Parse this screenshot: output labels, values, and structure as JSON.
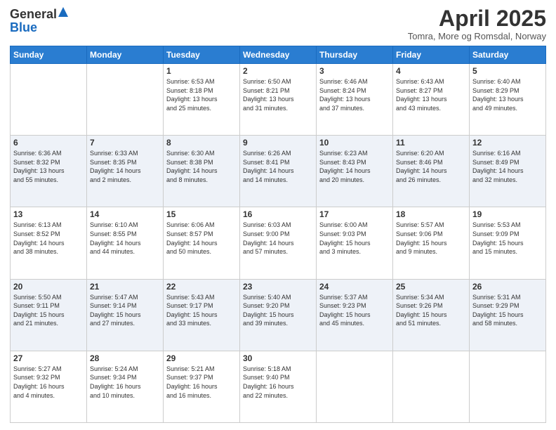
{
  "header": {
    "logo_line1": "General",
    "logo_line2": "Blue",
    "month_title": "April 2025",
    "location": "Tomra, More og Romsdal, Norway"
  },
  "days_of_week": [
    "Sunday",
    "Monday",
    "Tuesday",
    "Wednesday",
    "Thursday",
    "Friday",
    "Saturday"
  ],
  "weeks": [
    [
      {
        "day": "",
        "content": ""
      },
      {
        "day": "",
        "content": ""
      },
      {
        "day": "1",
        "content": "Sunrise: 6:53 AM\nSunset: 8:18 PM\nDaylight: 13 hours\nand 25 minutes."
      },
      {
        "day": "2",
        "content": "Sunrise: 6:50 AM\nSunset: 8:21 PM\nDaylight: 13 hours\nand 31 minutes."
      },
      {
        "day": "3",
        "content": "Sunrise: 6:46 AM\nSunset: 8:24 PM\nDaylight: 13 hours\nand 37 minutes."
      },
      {
        "day": "4",
        "content": "Sunrise: 6:43 AM\nSunset: 8:27 PM\nDaylight: 13 hours\nand 43 minutes."
      },
      {
        "day": "5",
        "content": "Sunrise: 6:40 AM\nSunset: 8:29 PM\nDaylight: 13 hours\nand 49 minutes."
      }
    ],
    [
      {
        "day": "6",
        "content": "Sunrise: 6:36 AM\nSunset: 8:32 PM\nDaylight: 13 hours\nand 55 minutes."
      },
      {
        "day": "7",
        "content": "Sunrise: 6:33 AM\nSunset: 8:35 PM\nDaylight: 14 hours\nand 2 minutes."
      },
      {
        "day": "8",
        "content": "Sunrise: 6:30 AM\nSunset: 8:38 PM\nDaylight: 14 hours\nand 8 minutes."
      },
      {
        "day": "9",
        "content": "Sunrise: 6:26 AM\nSunset: 8:41 PM\nDaylight: 14 hours\nand 14 minutes."
      },
      {
        "day": "10",
        "content": "Sunrise: 6:23 AM\nSunset: 8:43 PM\nDaylight: 14 hours\nand 20 minutes."
      },
      {
        "day": "11",
        "content": "Sunrise: 6:20 AM\nSunset: 8:46 PM\nDaylight: 14 hours\nand 26 minutes."
      },
      {
        "day": "12",
        "content": "Sunrise: 6:16 AM\nSunset: 8:49 PM\nDaylight: 14 hours\nand 32 minutes."
      }
    ],
    [
      {
        "day": "13",
        "content": "Sunrise: 6:13 AM\nSunset: 8:52 PM\nDaylight: 14 hours\nand 38 minutes."
      },
      {
        "day": "14",
        "content": "Sunrise: 6:10 AM\nSunset: 8:55 PM\nDaylight: 14 hours\nand 44 minutes."
      },
      {
        "day": "15",
        "content": "Sunrise: 6:06 AM\nSunset: 8:57 PM\nDaylight: 14 hours\nand 50 minutes."
      },
      {
        "day": "16",
        "content": "Sunrise: 6:03 AM\nSunset: 9:00 PM\nDaylight: 14 hours\nand 57 minutes."
      },
      {
        "day": "17",
        "content": "Sunrise: 6:00 AM\nSunset: 9:03 PM\nDaylight: 15 hours\nand 3 minutes."
      },
      {
        "day": "18",
        "content": "Sunrise: 5:57 AM\nSunset: 9:06 PM\nDaylight: 15 hours\nand 9 minutes."
      },
      {
        "day": "19",
        "content": "Sunrise: 5:53 AM\nSunset: 9:09 PM\nDaylight: 15 hours\nand 15 minutes."
      }
    ],
    [
      {
        "day": "20",
        "content": "Sunrise: 5:50 AM\nSunset: 9:11 PM\nDaylight: 15 hours\nand 21 minutes."
      },
      {
        "day": "21",
        "content": "Sunrise: 5:47 AM\nSunset: 9:14 PM\nDaylight: 15 hours\nand 27 minutes."
      },
      {
        "day": "22",
        "content": "Sunrise: 5:43 AM\nSunset: 9:17 PM\nDaylight: 15 hours\nand 33 minutes."
      },
      {
        "day": "23",
        "content": "Sunrise: 5:40 AM\nSunset: 9:20 PM\nDaylight: 15 hours\nand 39 minutes."
      },
      {
        "day": "24",
        "content": "Sunrise: 5:37 AM\nSunset: 9:23 PM\nDaylight: 15 hours\nand 45 minutes."
      },
      {
        "day": "25",
        "content": "Sunrise: 5:34 AM\nSunset: 9:26 PM\nDaylight: 15 hours\nand 51 minutes."
      },
      {
        "day": "26",
        "content": "Sunrise: 5:31 AM\nSunset: 9:29 PM\nDaylight: 15 hours\nand 58 minutes."
      }
    ],
    [
      {
        "day": "27",
        "content": "Sunrise: 5:27 AM\nSunset: 9:32 PM\nDaylight: 16 hours\nand 4 minutes."
      },
      {
        "day": "28",
        "content": "Sunrise: 5:24 AM\nSunset: 9:34 PM\nDaylight: 16 hours\nand 10 minutes."
      },
      {
        "day": "29",
        "content": "Sunrise: 5:21 AM\nSunset: 9:37 PM\nDaylight: 16 hours\nand 16 minutes."
      },
      {
        "day": "30",
        "content": "Sunrise: 5:18 AM\nSunset: 9:40 PM\nDaylight: 16 hours\nand 22 minutes."
      },
      {
        "day": "",
        "content": ""
      },
      {
        "day": "",
        "content": ""
      },
      {
        "day": "",
        "content": ""
      }
    ]
  ]
}
